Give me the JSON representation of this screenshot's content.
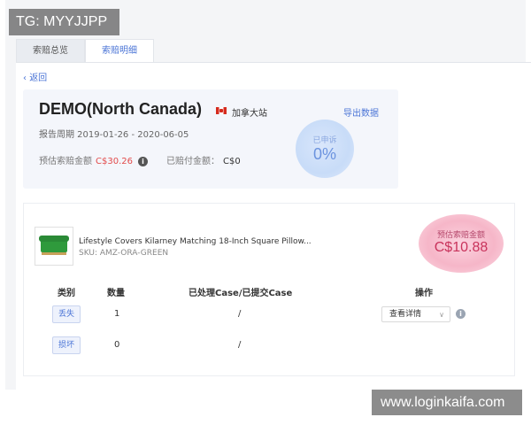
{
  "watermarks": {
    "tg": "TG: MYYJJPP",
    "site": "www.loginkaifa.com"
  },
  "tabs": [
    {
      "label": "索赔总览",
      "active": false
    },
    {
      "label": "索赔明细",
      "active": true
    }
  ],
  "back": {
    "label": "返回"
  },
  "store": {
    "name": "DEMO(North Canada)",
    "region": "加拿大站",
    "export_label": "导出数据",
    "period": "报告周期  2019-01-26 - 2020-06-05",
    "est_label": "预估索赔金额",
    "est_value": "C$30.26",
    "paid_label": "已赔付金额：",
    "paid_value": "C$0",
    "rate_label": "已申诉",
    "rate_value": "0%"
  },
  "product": {
    "title": "Lifestyle Covers Kilarney Matching 18-Inch Square Pillow...",
    "sku": "SKU: AMZ-ORA-GREEN",
    "est_label": "预估索赔金额",
    "est_value": "C$10.88"
  },
  "table": {
    "headers": {
      "type": "类别",
      "qty": "数量",
      "cases": "已处理Case/已提交Case",
      "action": "操作"
    },
    "rows": [
      {
        "type": "丢失",
        "qty": "1",
        "cases": "/",
        "action": "查看详情"
      },
      {
        "type": "损坏",
        "qty": "0",
        "cases": "/"
      }
    ]
  },
  "colors": {
    "accent": "#4a74d6",
    "danger": "#e24b4b"
  }
}
